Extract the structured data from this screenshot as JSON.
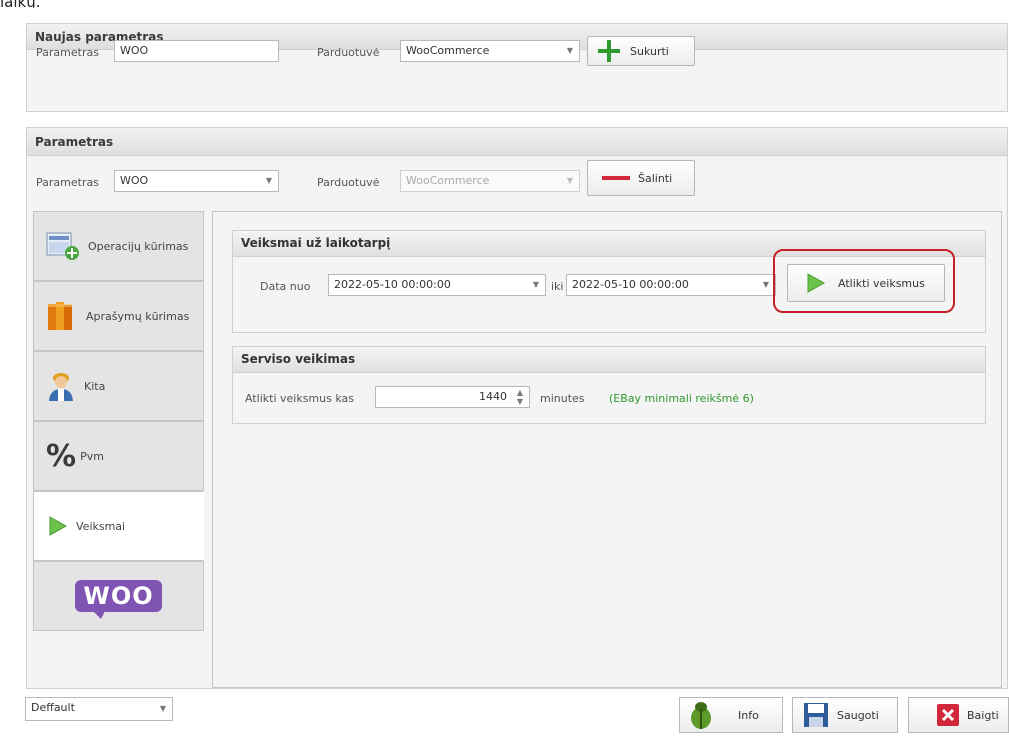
{
  "header_fragment": "laikų.",
  "new_param": {
    "title": "Naujas parametras",
    "param_label": "Parametras",
    "param_value": "WOO",
    "store_label": "Parduotuvė",
    "store_value": "WooCommerce",
    "create_label": "Sukurti"
  },
  "param": {
    "title": "Parametras",
    "param_label": "Parametras",
    "param_value": "WOO",
    "store_label": "Parduotuvė",
    "store_value": "WooCommerce",
    "delete_label": "Šalinti"
  },
  "tabs": [
    {
      "label": "Operacijų kūrimas",
      "icon": "create-operation-icon"
    },
    {
      "label": "Aprašymų kūrimas",
      "icon": "books-icon"
    },
    {
      "label": "Kita",
      "icon": "user-icon"
    },
    {
      "label": "Pvm",
      "icon": "percent-icon"
    },
    {
      "label": "Veiksmai",
      "icon": "play-icon"
    },
    {
      "label": "WOO",
      "icon": "woo-logo"
    }
  ],
  "actions": {
    "period_title": "Veiksmai už laikotarpį",
    "date_from_label": "Data nuo",
    "date_from": "2022-05-10 00:00:00",
    "to_label": "iki",
    "date_to": "2022-05-10 00:00:00",
    "run_label": "Atlikti veiksmus",
    "service_title": "Serviso veikimas",
    "run_every_label": "Atlikti veiksmus kas",
    "interval": "1440",
    "unit": "minutes",
    "note": "(EBay minimali reikšmė 6)"
  },
  "footer": {
    "profile": "Deffault",
    "info_label": "Info",
    "save_label": "Saugoti",
    "finish_label": "Baigti"
  },
  "colors": {
    "accent_green": "#2f9a2f",
    "delete_red": "#d0283a",
    "highlight_red": "#c8202a",
    "woo_purple": "#7f54b3"
  }
}
